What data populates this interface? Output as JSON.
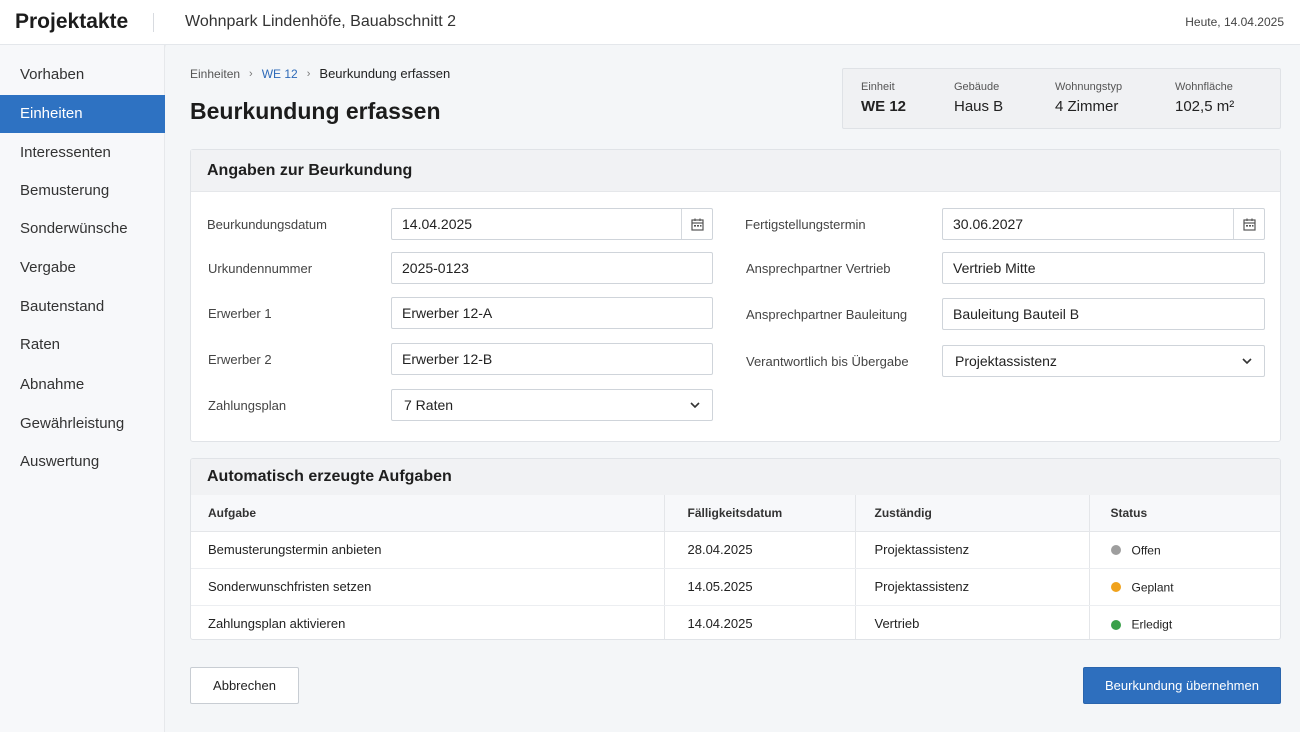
{
  "app": {
    "title": "Projektakte",
    "project": "Wohnpark Lindenhöfe, Bauabschnitt 2",
    "today": "Heute, 14.04.2025"
  },
  "sidebar": {
    "items": [
      {
        "label": "Vorhaben",
        "active": false
      },
      {
        "label": "Einheiten",
        "active": true
      },
      {
        "label": "Interessenten",
        "active": false
      },
      {
        "label": "Bemusterung",
        "active": false
      },
      {
        "label": "Sonderwünsche",
        "active": false
      },
      {
        "label": "Vergabe",
        "active": false
      },
      {
        "label": "Bautenstand",
        "active": false
      },
      {
        "label": "Raten",
        "active": false
      },
      {
        "label": "Abnahme",
        "active": false
      },
      {
        "label": "Gewährleistung",
        "active": false
      },
      {
        "label": "Auswertung",
        "active": false
      }
    ]
  },
  "breadcrumb": [
    "Einheiten",
    "WE 12",
    "Beurkundung erfassen"
  ],
  "page_title": "Beurkundung erfassen",
  "unit_info": {
    "einheit": {
      "label": "Einheit",
      "value": "WE 12"
    },
    "gebaeude": {
      "label": "Gebäude",
      "value": "Haus B"
    },
    "typ": {
      "label": "Wohnungstyp",
      "value": "4 Zimmer"
    },
    "flaeche": {
      "label": "Wohnfläche",
      "value": "102,5 m²"
    }
  },
  "form": {
    "title": "Angaben zur Beurkundung",
    "beurkundungsdatum": {
      "label": "Beurkundungsdatum",
      "value": "14.04.2025"
    },
    "urkundennummer": {
      "label": "Urkundennummer",
      "value": "2025-0123"
    },
    "erwerber1": {
      "label": "Erwerber 1",
      "value": "Erwerber 12-A"
    },
    "erwerber2": {
      "label": "Erwerber 2",
      "value": "Erwerber 12-B"
    },
    "zahlungsplan": {
      "label": "Zahlungsplan",
      "value": "7 Raten"
    },
    "fertigstellung": {
      "label": "Fertigstellungstermin",
      "value": "30.06.2027"
    },
    "vertrieb": {
      "label": "Ansprechpartner Vertrieb",
      "value": "Vertrieb Mitte"
    },
    "bauleitung": {
      "label": "Ansprechpartner Bauleitung",
      "value": "Bauleitung Bauteil B"
    },
    "verantwortlich": {
      "label": "Verantwortlich bis Übergabe",
      "value": "Projektassistenz"
    }
  },
  "tasks": {
    "title": "Automatisch erzeugte Aufgaben",
    "columns": [
      "Aufgabe",
      "Fälligkeitsdatum",
      "Zuständig",
      "Status"
    ],
    "rows": [
      {
        "aufgabe": "Bemusterungstermin anbieten",
        "datum": "28.04.2025",
        "zustaendig": "Projektassistenz",
        "status": "Offen",
        "color": "#9e9e9e"
      },
      {
        "aufgabe": "Sonderwunschfristen setzen",
        "datum": "14.05.2025",
        "zustaendig": "Projektassistenz",
        "status": "Geplant",
        "color": "#f0a21c"
      },
      {
        "aufgabe": "Zahlungsplan aktivieren",
        "datum": "14.04.2025",
        "zustaendig": "Vertrieb",
        "status": "Erledigt",
        "color": "#3aa04a"
      }
    ]
  },
  "actions": {
    "cancel": "Abbrechen",
    "submit": "Beurkundung übernehmen"
  },
  "colors": {
    "accent": "#2e72c2",
    "primary_button": "#2e6fbe"
  }
}
